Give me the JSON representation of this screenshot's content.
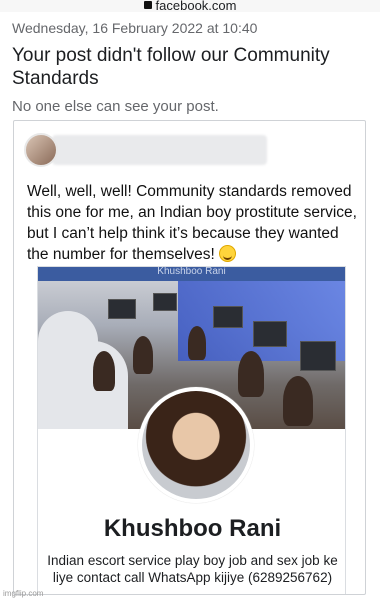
{
  "browser": {
    "url": "facebook.com"
  },
  "header": {
    "timestamp": "Wednesday, 16 February 2022 at 10:40",
    "title": "Your post didn't follow our Community Standards",
    "subtitle": "No one else can see your post."
  },
  "post": {
    "text": "Well, well, well! Community standards removed this one for me, an Indian boy prostitute service, but I can’t help think it’s because they wanted the number for themselves!",
    "emoji": "grinning-face"
  },
  "shared_profile": {
    "cover_bar_text": "Khushboo Rani",
    "name": "Khushboo Rani",
    "bio": "Indian escort service play boy job and sex job ke liye contact call WhatsApp kijiye (6289256762)"
  },
  "watermark": "imgflip.com"
}
